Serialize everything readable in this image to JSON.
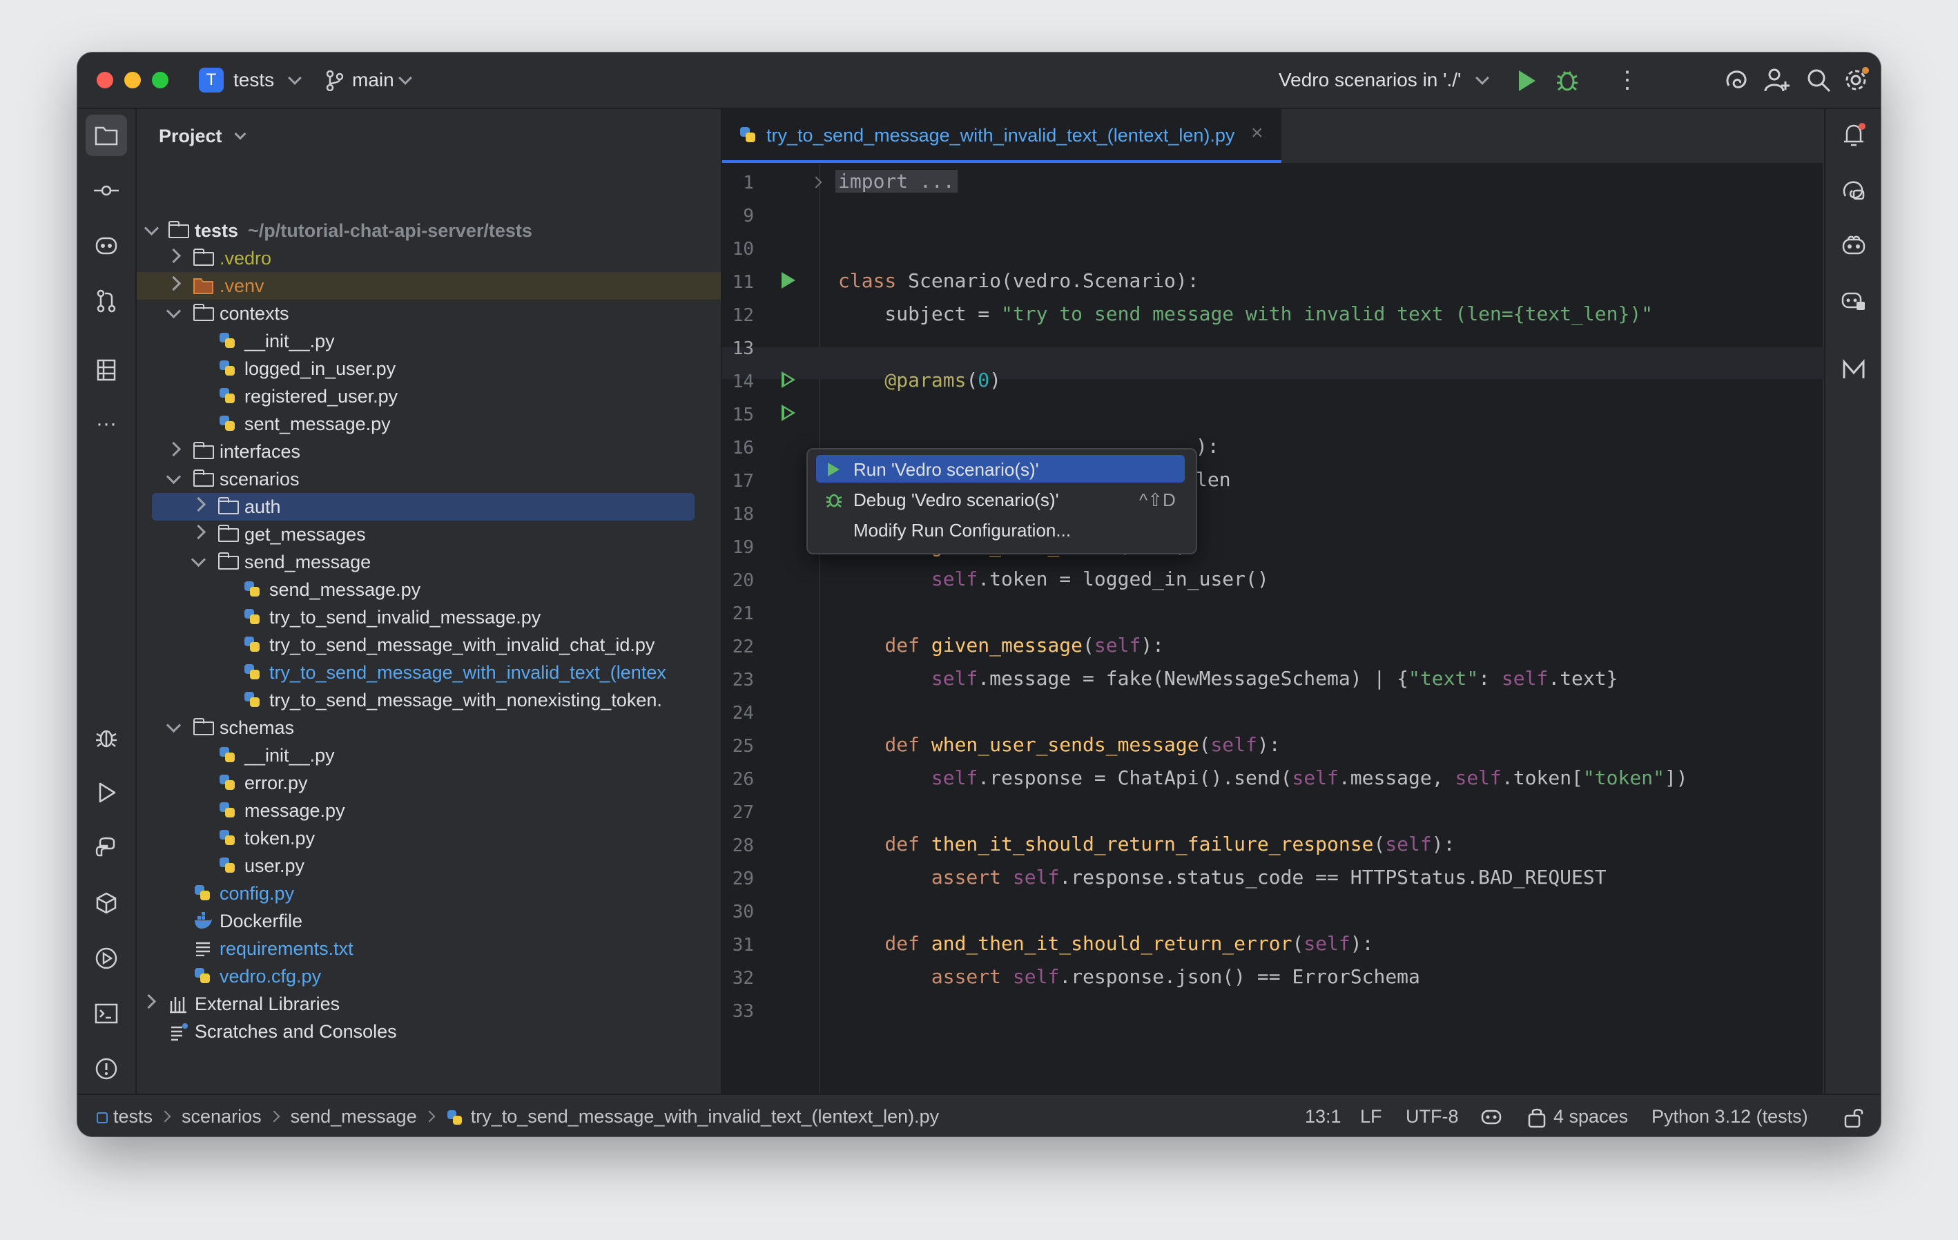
{
  "titlebar": {
    "project_badge": "T",
    "project_name": "tests",
    "branch": "main",
    "run_config": "Vedro scenarios in './'"
  },
  "project_panel": {
    "title": "Project",
    "tree": [
      {
        "label": "tests",
        "hint": "~/p/tutorial-chat-api-server/tests"
      },
      {
        "label": ".vedro"
      },
      {
        "label": ".venv"
      },
      {
        "label": "contexts"
      },
      {
        "label": "__init__.py"
      },
      {
        "label": "logged_in_user.py"
      },
      {
        "label": "registered_user.py"
      },
      {
        "label": "sent_message.py"
      },
      {
        "label": "interfaces"
      },
      {
        "label": "scenarios"
      },
      {
        "label": "auth"
      },
      {
        "label": "get_messages"
      },
      {
        "label": "send_message"
      },
      {
        "label": "send_message.py"
      },
      {
        "label": "try_to_send_invalid_message.py"
      },
      {
        "label": "try_to_send_message_with_invalid_chat_id.py"
      },
      {
        "label": "try_to_send_message_with_invalid_text_(lentex"
      },
      {
        "label": "try_to_send_message_with_nonexisting_token."
      },
      {
        "label": "schemas"
      },
      {
        "label": "__init__.py"
      },
      {
        "label": "error.py"
      },
      {
        "label": "message.py"
      },
      {
        "label": "token.py"
      },
      {
        "label": "user.py"
      },
      {
        "label": "config.py"
      },
      {
        "label": "Dockerfile"
      },
      {
        "label": "requirements.txt"
      },
      {
        "label": "vedro.cfg.py"
      },
      {
        "label": "External Libraries"
      },
      {
        "label": "Scratches and Consoles"
      }
    ]
  },
  "editor": {
    "tab_title": "try_to_send_message_with_invalid_text_(lentext_len).py",
    "line_numbers": [
      "1",
      "9",
      "10",
      "11",
      "12",
      "13",
      "14",
      "15",
      "16",
      "17",
      "18",
      "19",
      "20",
      "21",
      "22",
      "23",
      "24",
      "25",
      "26",
      "27",
      "28",
      "29",
      "30",
      "31",
      "32",
      "33"
    ],
    "fold_text": "import ...",
    "code": {
      "l11_kw": "class",
      "l11_rest": " Scenario(vedro.Scenario):",
      "l12_a": "    subject = ",
      "l12_str": "\"try to send message with invalid text (len={text_len})\"",
      "l14_dec": "    @params",
      "l14_open": "(",
      "l14_num": "0",
      "l14_close": ")",
      "l16_tail": "):",
      "l17_tail": "len",
      "l19_def": "    def ",
      "l19_fn": "given_user_token",
      "l19_open": "(",
      "l19_self": "self",
      "l19_close": "):",
      "l20_self": "        self",
      "l20_rest": ".token = logged_in_user()",
      "l22_def": "    def ",
      "l22_fn": "given_message",
      "l22_open": "(",
      "l22_self": "self",
      "l22_close": "):",
      "l23_self": "        self",
      "l23_a": ".message = fake(NewMessageSchema) | {",
      "l23_str": "\"text\"",
      "l23_b": ": ",
      "l23_self2": "self",
      "l23_c": ".text}",
      "l25_def": "    def ",
      "l25_fn": "when_user_sends_message",
      "l25_open": "(",
      "l25_self": "self",
      "l25_close": "):",
      "l26_self": "        self",
      "l26_a": ".response = ChatApi().send(",
      "l26_self2": "self",
      "l26_b": ".message, ",
      "l26_self3": "self",
      "l26_c": ".token[",
      "l26_str": "\"token\"",
      "l26_d": "])",
      "l28_def": "    def ",
      "l28_fn": "then_it_should_return_failure_response",
      "l28_open": "(",
      "l28_self": "self",
      "l28_close": "):",
      "l29_kw": "        assert ",
      "l29_self": "self",
      "l29_rest": ".response.status_code == HTTPStatus.BAD_REQUEST",
      "l31_def": "    def ",
      "l31_fn": "and_then_it_should_return_error",
      "l31_open": "(",
      "l31_self": "self",
      "l31_close": "):",
      "l32_kw": "        assert ",
      "l32_self": "self",
      "l32_rest": ".response.json() == ErrorSchema"
    }
  },
  "context_menu": {
    "items": [
      {
        "label": "Run 'Vedro scenario(s)'"
      },
      {
        "label": "Debug 'Vedro scenario(s)'",
        "shortcut": "^⇧D"
      },
      {
        "label": "Modify Run Configuration..."
      }
    ]
  },
  "statusbar": {
    "breadcrumbs": [
      "tests",
      "scenarios",
      "send_message",
      "try_to_send_message_with_invalid_text_(lentext_len).py"
    ],
    "position": "13:1",
    "line_sep": "LF",
    "encoding": "UTF-8",
    "indent": "4 spaces",
    "interpreter": "Python 3.12 (tests)"
  },
  "colors": {
    "accent": "#3574f0",
    "selection": "#2e55a8",
    "run_green": "#5fb865",
    "folder_yellow": "#b8b33a",
    "excluded_orange": "#d4863a",
    "link_blue": "#56a8f5"
  }
}
